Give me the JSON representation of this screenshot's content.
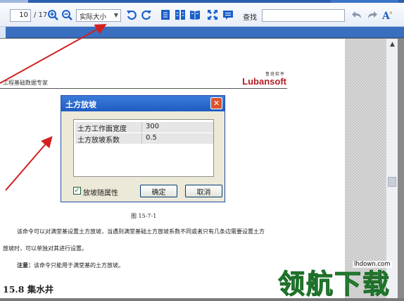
{
  "toolbar": {
    "page_current": "10",
    "page_total": "/ 17",
    "zoom_value": "实际大小",
    "search_label": "查找",
    "search_placeholder": ""
  },
  "page": {
    "header_text": "工程基础数据专家",
    "logo_sub": "鲁班软件",
    "logo_main": "Lubansoft"
  },
  "dialog": {
    "title": "土方放坡",
    "rows": [
      {
        "label": "土方工作面宽度(mm)",
        "value": "300"
      },
      {
        "label": "土方放坡系数",
        "value": "0.5"
      }
    ],
    "checkbox_label": "放坡随属性",
    "checkbox_checked": "✓",
    "ok_label": "确定",
    "cancel_label": "取消"
  },
  "content": {
    "caption": "图 15-7-1",
    "para1": "该命令可以对满堂基设置土方放坡，当遇到满堂基础土方放坡系数不同或者只有几条边需要设置土方",
    "para2": "放坡时，可以单独对其进行设置。",
    "note_label": "注意：",
    "note_text": "该命令只能用于满堂基的土方放坡。",
    "section_heading": "15.8 集水井"
  },
  "watermark": {
    "text": "领航下载",
    "url": "lhdown.com"
  },
  "colors": {
    "toolbar_icon_blue": "#1a5fc8",
    "arrow_red": "#d42020",
    "watermark_green": "#2c9a3a",
    "logo_red": "#b11d23"
  }
}
